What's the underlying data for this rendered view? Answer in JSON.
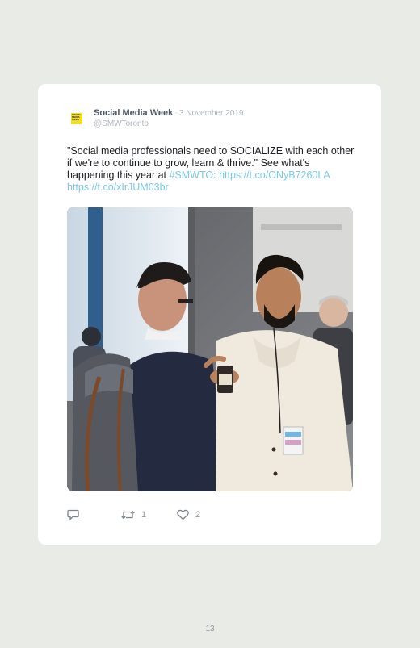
{
  "tweet": {
    "author_name": "Social Media Week",
    "separator": "·",
    "date": "3 November 2019",
    "handle": "@SMWToronto",
    "avatar_logo_text": "SOCIAL MEDIA WEEK",
    "text_before": "\"Social media professionals need to SOCIALIZE with each other if we're to continue to grow, learn & thrive.\" See what's happening this year at ",
    "hashtag": "#SMWTO",
    "text_colon": ": ",
    "link1": "https://t.co/ONyB7260LA",
    "link2": "https://t.co/xIrJUM03br",
    "image_description": "photo-of-two-men-talking-at-conference"
  },
  "actions": {
    "reply_icon": "reply-icon",
    "retweet_icon": "retweet-icon",
    "retweet_count": "1",
    "like_icon": "heart-icon",
    "like_count": "2"
  },
  "page": {
    "number": "13"
  },
  "colors": {
    "background": "#e9ebe7",
    "card": "#ffffff",
    "link": "#7dc8ea",
    "muted": "#b0b6bd"
  }
}
